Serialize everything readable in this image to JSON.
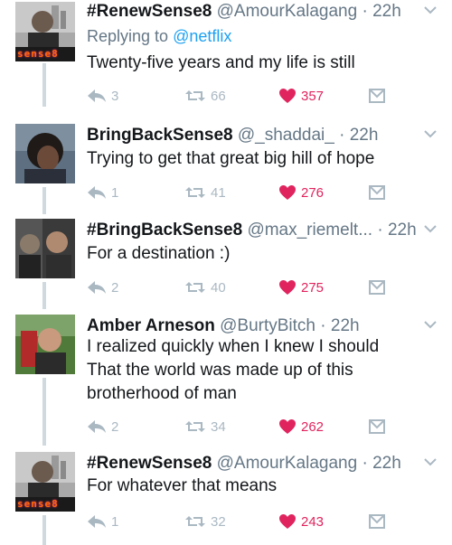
{
  "tweets": [
    {
      "name": "#RenewSense8",
      "handle": "@AmourKalagang",
      "time": "22h",
      "reply_prefix": "Replying to ",
      "reply_to": "@netflix",
      "text": [
        "Twenty-five years and my life is still"
      ],
      "replies": "3",
      "retweets": "66",
      "likes": "357",
      "avatar_label": "sense8"
    },
    {
      "name": "BringBackSense8",
      "handle": "@_shaddai_",
      "time": "22h",
      "text": [
        "Trying to get that great big hill of hope"
      ],
      "replies": "1",
      "retweets": "41",
      "likes": "276"
    },
    {
      "name": "#BringBackSense8",
      "handle": "@max_riemelt...",
      "time": "22h",
      "text": [
        "For a destination :)"
      ],
      "replies": "2",
      "retweets": "40",
      "likes": "275"
    },
    {
      "name": "Amber Arneson",
      "handle": "@BurtyBitch",
      "time": "22h",
      "text": [
        "I realized quickly when I knew I should",
        "That the world was made up of this",
        "brotherhood of man"
      ],
      "replies": "2",
      "retweets": "34",
      "likes": "262"
    },
    {
      "name": "#RenewSense8",
      "handle": "@AmourKalagang",
      "time": "22h",
      "text": [
        "For whatever that means"
      ],
      "replies": "1",
      "retweets": "32",
      "likes": "243",
      "avatar_label": "sense8"
    }
  ],
  "colors": {
    "accent": "#1da1f2",
    "like": "#e0245e",
    "icon_gray": "#aab8c2",
    "meta_gray": "#657786",
    "thread_line": "#cfd9de"
  },
  "icons": [
    "reply-icon",
    "retweet-icon",
    "heart-icon",
    "direct-message-icon",
    "chevron-down-icon"
  ]
}
